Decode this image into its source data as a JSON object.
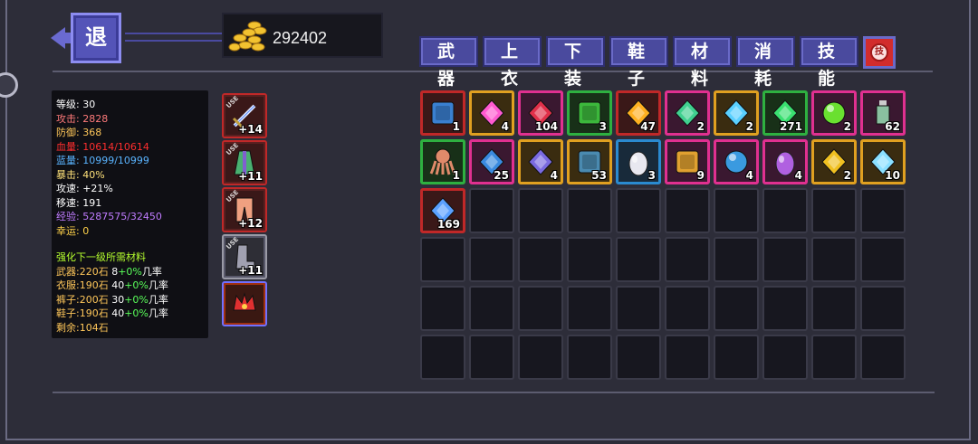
{
  "back_button": {
    "label": "退"
  },
  "gold": {
    "amount": "292402"
  },
  "tabs": [
    "武器",
    "上衣",
    "下装",
    "鞋子",
    "材料",
    "消耗",
    "技能"
  ],
  "skill_tab_icon": "技",
  "stats": {
    "rows": [
      {
        "label": "等级:",
        "value": "30",
        "color": "#ffffff"
      },
      {
        "label": "攻击:",
        "value": "2828",
        "color": "#ff7a7a"
      },
      {
        "label": "防御:",
        "value": "368",
        "color": "#ffc75a"
      },
      {
        "label": "血量:",
        "value": "10614/10614",
        "color": "#ff2e2e"
      },
      {
        "label": "蓝量:",
        "value": "10999/10999",
        "color": "#5ab4ff"
      },
      {
        "label": "暴击:",
        "value": "40%",
        "color": "#ffe27a"
      },
      {
        "label": "攻速:",
        "value": "+21%",
        "color": "#ffffff"
      },
      {
        "label": "移速:",
        "value": "191",
        "color": "#ffffff"
      },
      {
        "label": "经验:",
        "value": "5287575/32450",
        "color": "#c07cff"
      },
      {
        "label": "幸运:",
        "value": "0",
        "color": "#ffd24a"
      }
    ],
    "upgrade_title": "强化下一级所需材料",
    "upgrade_rows": [
      {
        "label": "武器:220石",
        "level": "8",
        "rate": "+0%",
        "suffix": "几率"
      },
      {
        "label": "衣服:190石",
        "level": "40",
        "rate": "+0%",
        "suffix": "几率"
      },
      {
        "label": "裤子:200石",
        "level": "30",
        "rate": "+0%",
        "suffix": "几率"
      },
      {
        "label": "鞋子:190石",
        "level": "40",
        "rate": "+0%",
        "suffix": "几率"
      }
    ],
    "remaining": "剩余:104石"
  },
  "equipment": [
    {
      "slot": "weapon",
      "icon": "sword-icon",
      "level": "+14",
      "use": "USE",
      "style": "red"
    },
    {
      "slot": "armor",
      "icon": "robe-icon",
      "level": "+11",
      "use": "USE",
      "style": "red"
    },
    {
      "slot": "pants",
      "icon": "pants-icon",
      "level": "+12",
      "use": "USE",
      "style": "red"
    },
    {
      "slot": "boots",
      "icon": "boots-icon",
      "level": "+11",
      "use": "USE",
      "style": "gray"
    },
    {
      "slot": "accessory",
      "icon": "demon-crown-icon",
      "level": "",
      "use": "",
      "style": "purple"
    }
  ],
  "inventory": [
    {
      "icon": "spellbook-icon",
      "count": "1",
      "border": "#c02828",
      "bg": "#3a1818",
      "color": "#3a7fd0"
    },
    {
      "icon": "rainbow-flower-icon",
      "count": "4",
      "border": "#e0a020",
      "bg": "#3a2c10",
      "color": "#ff5ad0"
    },
    {
      "icon": "red-crystal-icon",
      "count": "104",
      "border": "#e03090",
      "bg": "#3a1830",
      "color": "#e0304a"
    },
    {
      "icon": "green-slime-cube-icon",
      "count": "3",
      "border": "#2eb040",
      "bg": "#183018",
      "color": "#3cb83c"
    },
    {
      "icon": "fire-key-icon",
      "count": "47",
      "border": "#c02828",
      "bg": "#3a1818",
      "color": "#ffb020"
    },
    {
      "icon": "green-serpent-icon",
      "count": "2",
      "border": "#e03090",
      "bg": "#3a1830",
      "color": "#40d090"
    },
    {
      "icon": "compass-shield-icon",
      "count": "2",
      "border": "#e0a020",
      "bg": "#3a2c10",
      "color": "#5ad0ff"
    },
    {
      "icon": "green-star-burst-icon",
      "count": "271",
      "border": "#2eb040",
      "bg": "#183018",
      "color": "#3ae070"
    },
    {
      "icon": "green-orb-icon",
      "count": "2",
      "border": "#e03090",
      "bg": "#3a1830",
      "color": "#6ae030"
    },
    {
      "icon": "potion-bottle-icon",
      "count": "62",
      "border": "#e03090",
      "bg": "#3a1830",
      "color": "#8ac0a0"
    },
    {
      "icon": "octopus-icon",
      "count": "1",
      "border": "#2eb040",
      "bg": "#183018",
      "color": "#e08a6a"
    },
    {
      "icon": "sapphire-amulet-icon",
      "count": "25",
      "border": "#e03090",
      "bg": "#3a1830",
      "color": "#3a8ae0"
    },
    {
      "icon": "crystal-cluster-icon",
      "count": "4",
      "border": "#e0a020",
      "bg": "#3a2c10",
      "color": "#7a6ae0"
    },
    {
      "icon": "rune-tablet-icon",
      "count": "53",
      "border": "#e0a020",
      "bg": "#3a2c10",
      "color": "#4a8ab0"
    },
    {
      "icon": "white-egg-icon",
      "count": "3",
      "border": "#2a8ad0",
      "bg": "#182a3a",
      "color": "#e8e8f0"
    },
    {
      "icon": "gold-ore-icon",
      "count": "9",
      "border": "#e03090",
      "bg": "#3a1830",
      "color": "#e0a030"
    },
    {
      "icon": "blue-pearl-icon",
      "count": "4",
      "border": "#e03090",
      "bg": "#3a1830",
      "color": "#3a9ae0"
    },
    {
      "icon": "purple-egg-icon",
      "count": "4",
      "border": "#e03090",
      "bg": "#3a1830",
      "color": "#b060e0"
    },
    {
      "icon": "gold-emblem-icon",
      "count": "2",
      "border": "#e0a020",
      "bg": "#3a2c10",
      "color": "#f0c020"
    },
    {
      "icon": "ice-crystal-icon",
      "count": "10",
      "border": "#e0a020",
      "bg": "#3a2c10",
      "color": "#8ae0ff"
    },
    {
      "icon": "blue-gems-icon",
      "count": "169",
      "border": "#c02828",
      "bg": "#3a1818",
      "color": "#5aa0ff"
    }
  ],
  "total_slots": 60
}
